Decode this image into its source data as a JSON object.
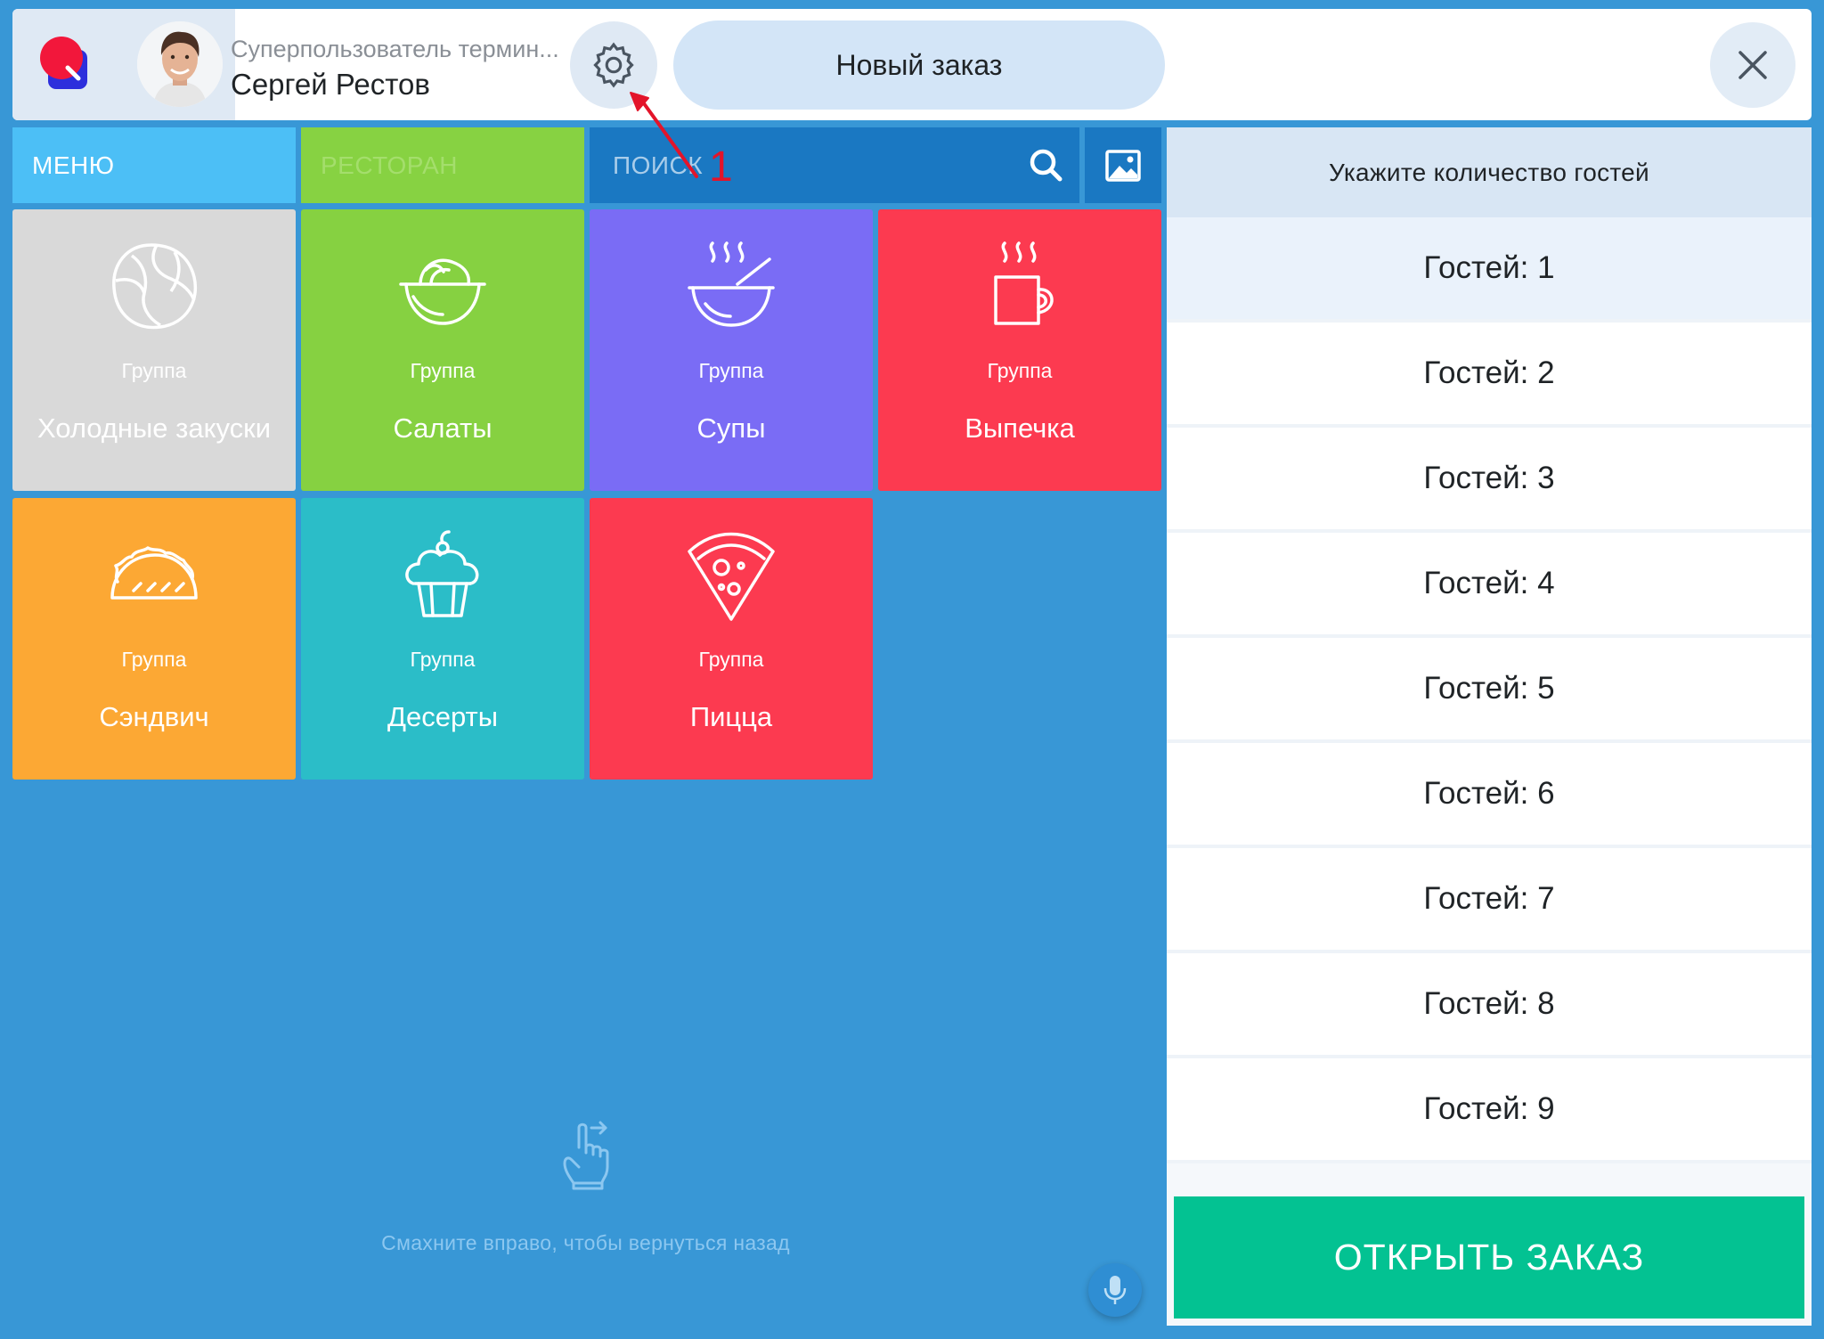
{
  "header": {
    "user_role": "Суперпользователь термин...",
    "user_name": "Сергей Рестов",
    "new_order_label": "Новый заказ"
  },
  "nav": {
    "menu_tab": "МЕНЮ",
    "restaurant_tab": "РЕСТОРАН",
    "search_placeholder": "ПОИСК"
  },
  "tiles": [
    {
      "group": "Группа",
      "name": "Холодные закуски",
      "color": "#d9d9d9",
      "icon": "cabbage-icon"
    },
    {
      "group": "Группа",
      "name": "Салаты",
      "color": "#86d141",
      "icon": "salad-bowl-icon"
    },
    {
      "group": "Группа",
      "name": "Супы",
      "color": "#7a6cf5",
      "icon": "soup-bowl-icon"
    },
    {
      "group": "Группа",
      "name": "Выпечка",
      "color": "#fc3a50",
      "icon": "coffee-cup-icon"
    },
    {
      "group": "Группа",
      "name": "Сэндвич",
      "color": "#fca834",
      "icon": "taco-icon"
    },
    {
      "group": "Группа",
      "name": "Десерты",
      "color": "#2bbdc8",
      "icon": "cupcake-icon"
    },
    {
      "group": "Группа",
      "name": "Пицца",
      "color": "#fc3a50",
      "icon": "pizza-slice-icon"
    }
  ],
  "hint": {
    "text": "Смахните вправо, чтобы вернуться назад"
  },
  "guests": {
    "title": "Укажите количество гостей",
    "options": [
      "Гостей: 1",
      "Гостей: 2",
      "Гостей: 3",
      "Гостей: 4",
      "Гостей: 5",
      "Гостей: 6",
      "Гостей: 7",
      "Гостей: 8",
      "Гостей: 9"
    ],
    "selected_index": 0,
    "open_order_label": "ОТКРЫТЬ ЗАКАЗ"
  },
  "annotation": {
    "number": "1",
    "color": "#e3142a"
  }
}
